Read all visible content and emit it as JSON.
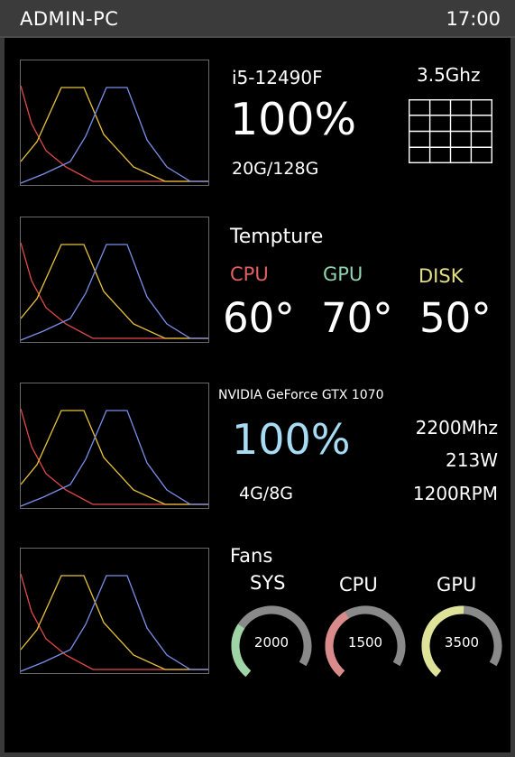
{
  "header": {
    "hostname": "ADMIN-PC",
    "time": "17:00"
  },
  "cpu": {
    "model": "i5-12490F",
    "usage": "100%",
    "memory": "20G/128G",
    "clock": "3.5Ghz"
  },
  "temperature": {
    "title": "Tempture",
    "items": [
      {
        "label": "CPU",
        "value": "60°",
        "color": "#e06060"
      },
      {
        "label": "GPU",
        "value": "70°",
        "color": "#8fd4ae"
      },
      {
        "label": "DISK",
        "value": "50°",
        "color": "#e4de86"
      }
    ]
  },
  "gpu": {
    "model": "NVIDIA GeForce GTX 1070",
    "usage": "100%",
    "memory": "4G/8G",
    "clock": "2200Mhz",
    "power": "213W",
    "fan": "1200RPM",
    "usage_color": "#a8dcf4"
  },
  "fans": {
    "title": "Fans",
    "items": [
      {
        "label": "SYS",
        "value": "2000",
        "fill": 0.32,
        "color": "#9fd4a6"
      },
      {
        "label": "CPU",
        "value": "1500",
        "fill": 0.42,
        "color": "#d98a8a"
      },
      {
        "label": "GPU",
        "value": "3500",
        "fill": 0.55,
        "color": "#dfe39a"
      }
    ]
  },
  "graph_colors": {
    "red": "#e34a4a",
    "yellow": "#e7c43a",
    "blue": "#7b8ee8"
  }
}
